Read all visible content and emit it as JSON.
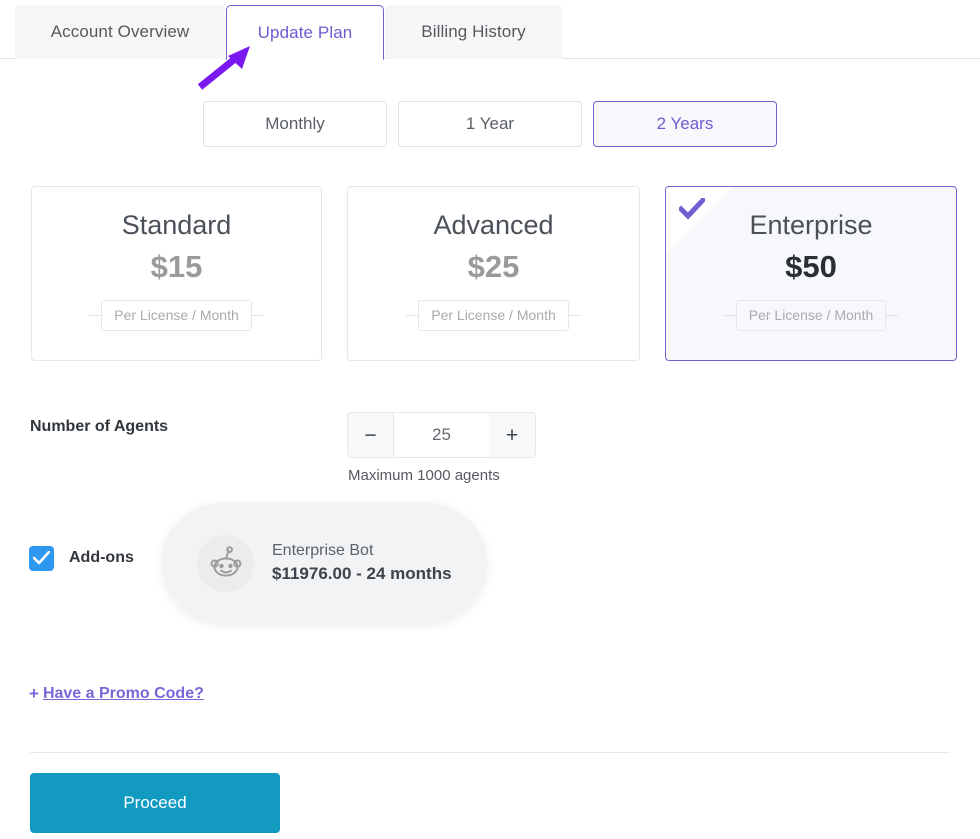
{
  "tabs": [
    {
      "label": "Account Overview",
      "active": false
    },
    {
      "label": "Update Plan",
      "active": true
    },
    {
      "label": "Billing History",
      "active": false
    }
  ],
  "annotation": {
    "type": "arrow-pointer",
    "color": "#7a18f0",
    "points_to": "Update Plan"
  },
  "billing_cycles": [
    {
      "label": "Monthly",
      "selected": false
    },
    {
      "label": "1 Year",
      "selected": false
    },
    {
      "label": "2 Years",
      "selected": true
    }
  ],
  "plans": [
    {
      "name": "Standard",
      "price": "$15",
      "meta": "Per License / Month",
      "selected": false
    },
    {
      "name": "Advanced",
      "price": "$25",
      "meta": "Per License / Month",
      "selected": false
    },
    {
      "name": "Enterprise",
      "price": "$50",
      "meta": "Per License / Month",
      "selected": true
    }
  ],
  "agents": {
    "label": "Number of Agents",
    "decrement_label": "−",
    "value": "25",
    "increment_label": "+",
    "hint": "Maximum 1000 agents"
  },
  "addons": {
    "label": "Add-ons",
    "checked": true,
    "items": [
      {
        "title": "Enterprise Bot",
        "price": "$11976.00 - 24 months",
        "icon": "reddit-snoo-icon"
      }
    ]
  },
  "promo": {
    "plus": "+",
    "label": "Have a Promo Code?"
  },
  "footer": {
    "proceed_label": "Proceed"
  },
  "colors": {
    "accent_purple": "#6e5bd0",
    "checkbox_blue": "#2e97f0",
    "proceed_teal": "#129ac1",
    "annotation_purple": "#7a18f0"
  }
}
